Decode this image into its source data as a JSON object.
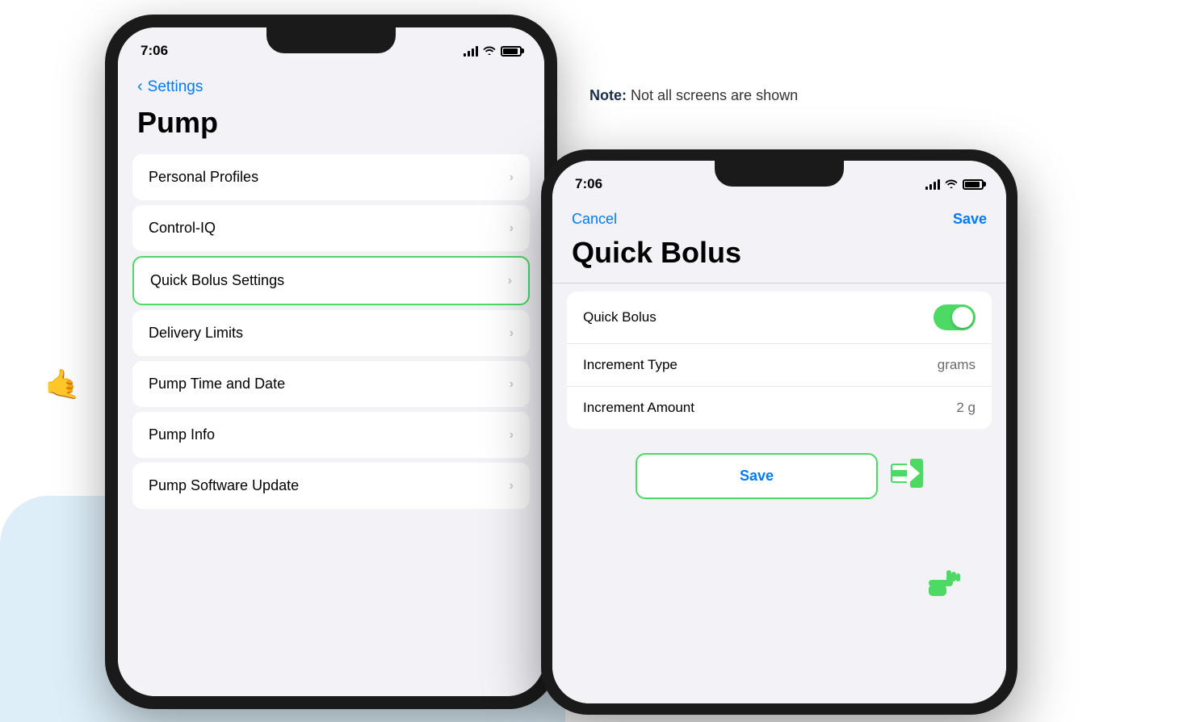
{
  "note": {
    "prefix": "Note:",
    "text": " Not all screens are shown"
  },
  "phone1": {
    "status": {
      "time": "7:06"
    },
    "nav": {
      "back_label": "Settings"
    },
    "title": "Pump",
    "menu_items": [
      {
        "id": "personal-profiles",
        "label": "Personal Profiles",
        "selected": false
      },
      {
        "id": "control-iq",
        "label": "Control-IQ",
        "selected": false
      },
      {
        "id": "quick-bolus-settings",
        "label": "Quick Bolus Settings",
        "selected": true
      },
      {
        "id": "delivery-limits",
        "label": "Delivery Limits",
        "selected": false
      },
      {
        "id": "pump-time-date",
        "label": "Pump Time and Date",
        "selected": false
      },
      {
        "id": "pump-info",
        "label": "Pump Info",
        "selected": false
      },
      {
        "id": "pump-software-update",
        "label": "Pump Software Update",
        "selected": false
      }
    ]
  },
  "phone2": {
    "status": {
      "time": "7:06"
    },
    "nav": {
      "cancel": "Cancel",
      "save": "Save"
    },
    "title": "Quick Bolus",
    "rows": [
      {
        "id": "quick-bolus-toggle",
        "label": "Quick Bolus",
        "value": "toggle_on",
        "type": "toggle"
      },
      {
        "id": "increment-type",
        "label": "Increment Type",
        "value": "grams",
        "type": "text"
      },
      {
        "id": "increment-amount",
        "label": "Increment Amount",
        "value": "2 g",
        "type": "text"
      }
    ],
    "save_button": "Save"
  }
}
